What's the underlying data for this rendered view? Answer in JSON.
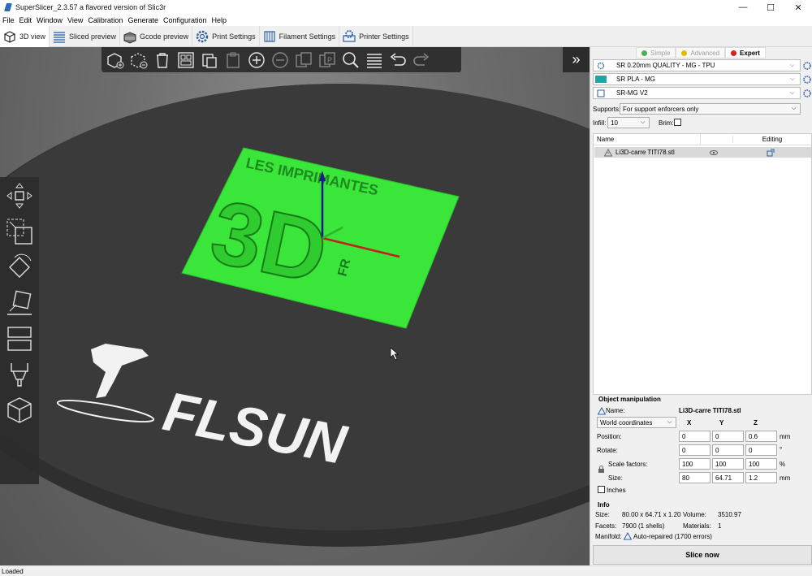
{
  "window": {
    "title": "SuperSlicer_2.3.57 a flavored version of Slic3r",
    "minimize": "—",
    "maximize": "☐",
    "close": "✕"
  },
  "menu": [
    "File",
    "Edit",
    "Window",
    "View",
    "Calibration",
    "Generate",
    "Configuration",
    "Help"
  ],
  "tabs": [
    {
      "label": "3D view",
      "icon": "cube-icon",
      "active": true
    },
    {
      "label": "Sliced preview",
      "icon": "layers-icon"
    },
    {
      "label": "Gcode preview",
      "icon": "gcode-icon"
    },
    {
      "label": "Print Settings",
      "icon": "gear-icon"
    },
    {
      "label": "Filament Settings",
      "icon": "spool-icon"
    },
    {
      "label": "Printer Settings",
      "icon": "printer-gear-icon"
    }
  ],
  "mode": {
    "simple": "Simple",
    "advanced": "Advanced",
    "expert": "Expert",
    "colors": {
      "simple": "#4caf50",
      "advanced": "#e6b800",
      "expert": "#d61f1f"
    }
  },
  "presets": {
    "print": "SR 0.20mm QUALITY - MG - TPU",
    "filament": "SR PLA - MG",
    "filament_color": "#1fa7a8",
    "printer": "SR-MG V2"
  },
  "supports": {
    "label": "Supports:",
    "value": "For support enforcers only"
  },
  "infill": {
    "label": "Infill:",
    "value": "10"
  },
  "brim": {
    "label": "Brim:"
  },
  "object_list": {
    "col_name": "Name",
    "col_editing": "Editing",
    "items": [
      {
        "name": "Li3D-carre TITI78.stl"
      }
    ]
  },
  "object_manipulation": {
    "title": "Object manipulation",
    "name_label": "Name:",
    "name_value": "Li3D-carre TITI78.stl",
    "coord_system": "World coordinates",
    "x": "X",
    "y": "Y",
    "z": "Z",
    "position_label": "Position:",
    "position": [
      "0",
      "0",
      "0.6"
    ],
    "position_unit": "mm",
    "rotate_label": "Rotate:",
    "rotate": [
      "0",
      "0",
      "0"
    ],
    "rotate_unit": "°",
    "scale_label": "Scale factors:",
    "scale": [
      "100",
      "100",
      "100"
    ],
    "scale_unit": "%",
    "size_label": "Size:",
    "size": [
      "80",
      "64.71",
      "1.2"
    ],
    "size_unit": "mm",
    "inches_label": "Inches"
  },
  "info": {
    "title": "Info",
    "size_label": "Size:",
    "size_value": "80.00 x 64.71 x 1.20",
    "volume_label": "Volume:",
    "volume_value": "3510.97",
    "facets_label": "Facets:",
    "facets_value": "7900 (1 shells)",
    "materials_label": "Materials:",
    "materials_value": "1",
    "manifold_label": "Manifold:",
    "manifold_value": "Auto-repaired (1700 errors)"
  },
  "slice_button": "Slice now",
  "status": "Loaded",
  "scene": {
    "plate_text_top": "LES IMPRIMANTES",
    "plate_text_big": "3D",
    "plate_text_small": "FR",
    "bed_logo": "FLSUN",
    "plate_color": "#39e639"
  }
}
